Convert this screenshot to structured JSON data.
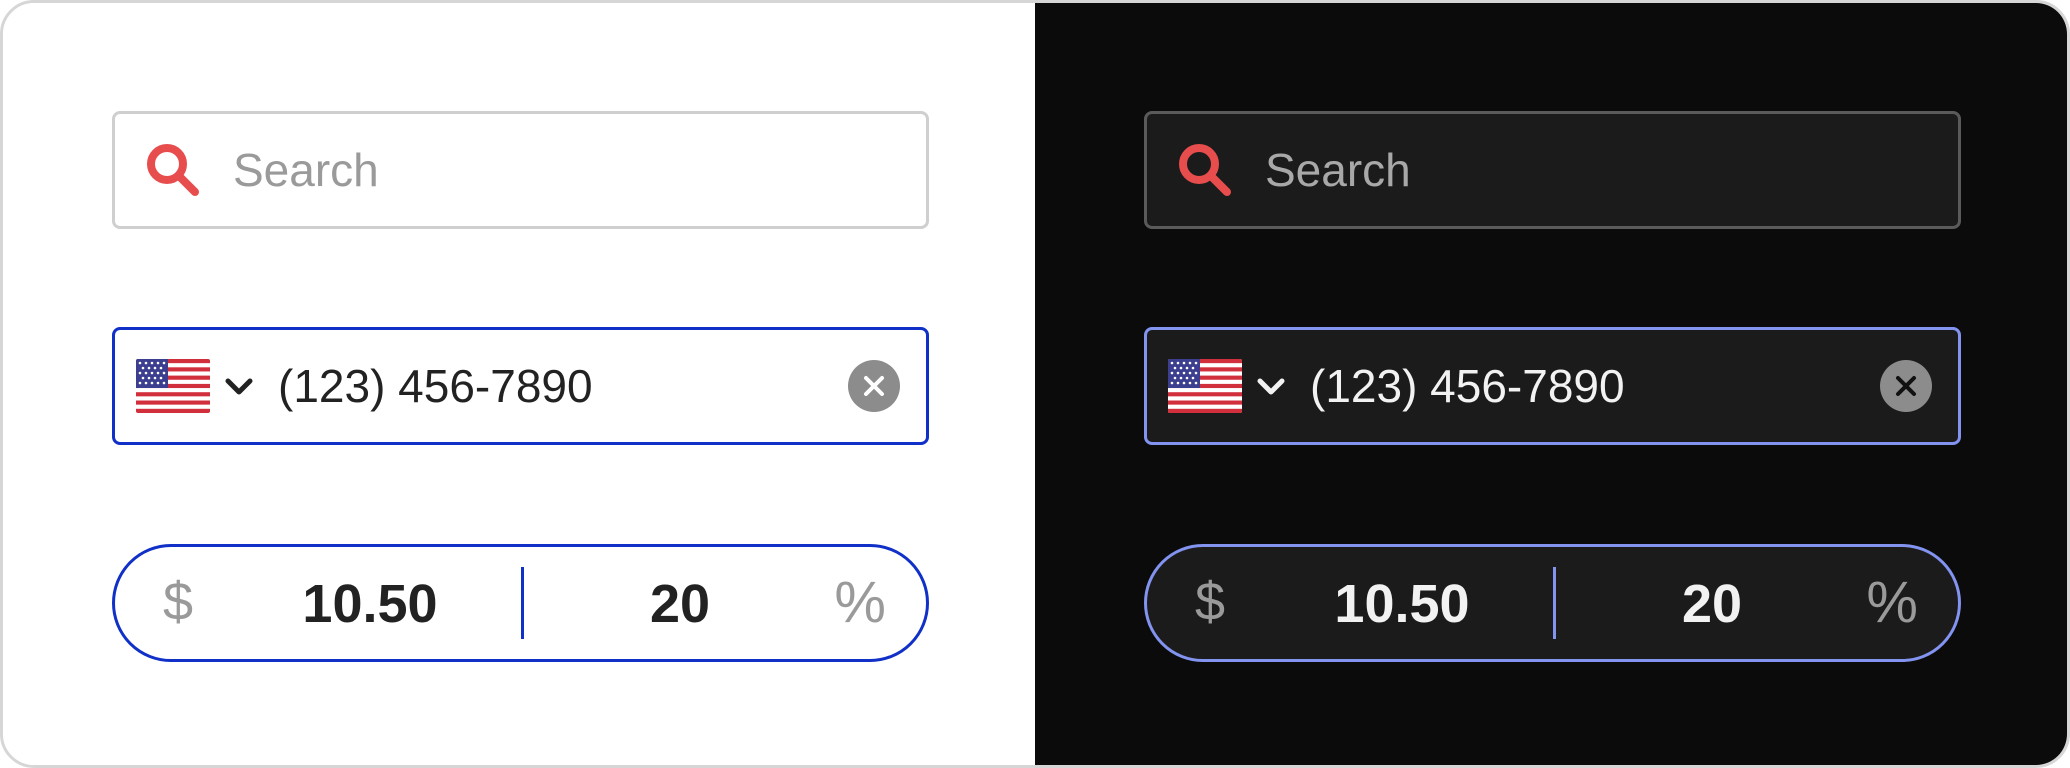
{
  "search": {
    "placeholder": "Search",
    "icon": "search-icon",
    "icon_color": "#e84d4d"
  },
  "phone": {
    "country_flag": "us-flag-icon",
    "dropdown_icon": "chevron-down-icon",
    "value": "(123) 456-7890",
    "clear_icon": "close-icon"
  },
  "money": {
    "currency_symbol": "$",
    "amount": "10.50",
    "percent": "20",
    "percent_symbol": "%"
  },
  "colors": {
    "accent_light": "#1030c8",
    "accent_dark": "#8293f0",
    "search_icon": "#e84d4d"
  }
}
